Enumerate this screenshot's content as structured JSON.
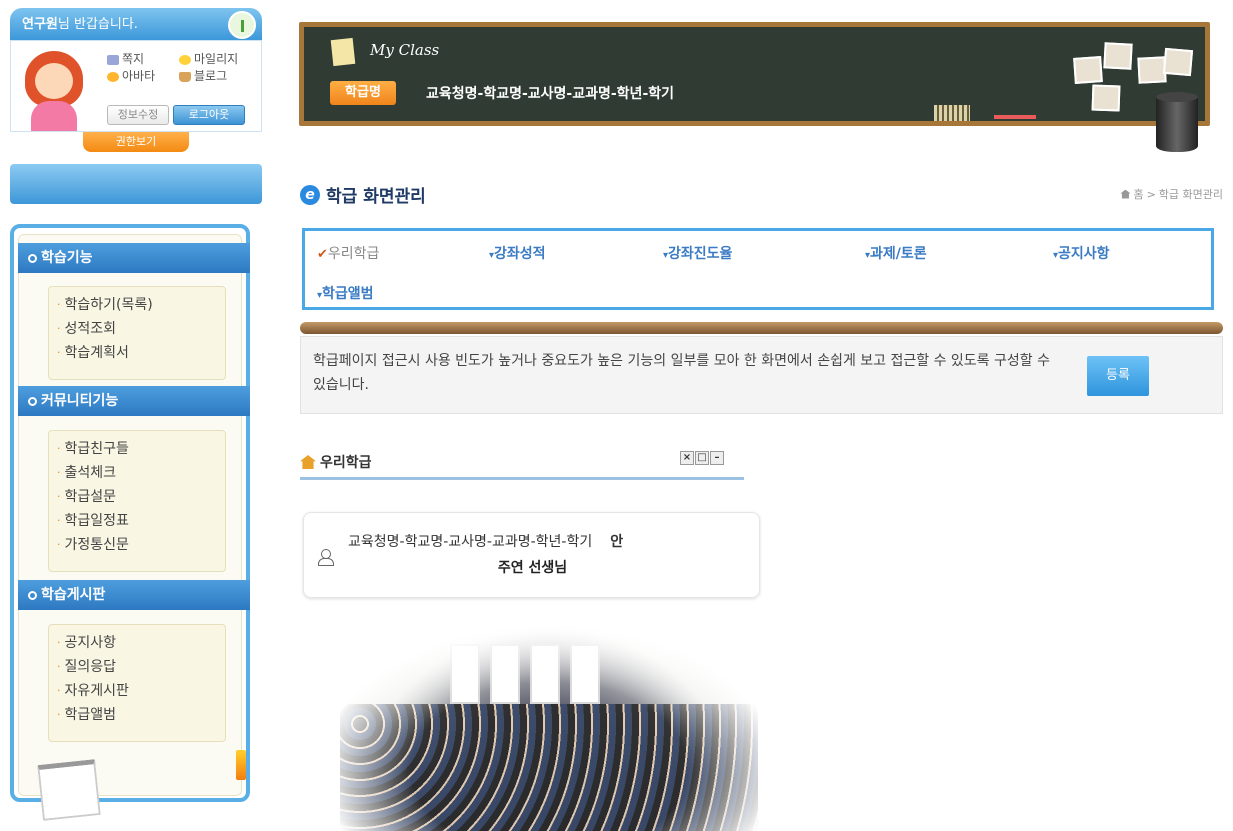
{
  "profile": {
    "user": "연구원",
    "greeting": "님 반갑습니다.",
    "menu": [
      {
        "label": "쪽지",
        "icon": "note-icon"
      },
      {
        "label": "마일리지",
        "icon": "coin-icon"
      },
      {
        "label": "아바타",
        "icon": "smile-icon"
      },
      {
        "label": "블로그",
        "icon": "blog-icon"
      }
    ],
    "edit_label": "정보수정",
    "logout_label": "로그아웃",
    "permission_label": "권한보기"
  },
  "sidebar": {
    "sections": [
      {
        "title": "학습기능",
        "items": [
          "학습하기(목록)",
          "성적조회",
          "학습계획서"
        ]
      },
      {
        "title": "커뮤니티기능",
        "items": [
          "학급친구들",
          "출석체크",
          "학급설문",
          "학급일정표",
          "가정통신문"
        ]
      },
      {
        "title": "학습게시판",
        "items": [
          "공지사항",
          "질의응답",
          "자유게시판",
          "학급앨범"
        ]
      }
    ]
  },
  "banner": {
    "title": "My Class",
    "tab_label": "학급명",
    "class_info": "교육청명-학교명-교사명-교과명-학년-학기"
  },
  "page": {
    "title": "학급 화면관리",
    "breadcrumb": [
      "홈",
      ">",
      "학급 화면관리"
    ]
  },
  "tabs": [
    {
      "label": "우리학급",
      "active": true
    },
    {
      "label": "강좌성적",
      "active": false
    },
    {
      "label": "강좌진도율",
      "active": false
    },
    {
      "label": "과제/토론",
      "active": false
    },
    {
      "label": "공지사항",
      "active": false
    },
    {
      "label": "학급앨범",
      "active": false
    }
  ],
  "description": {
    "text": "학급페이지 접근시 사용 빈도가 높거나 중요도가 높은 기능의 일부를 모아 한 화면에서 손쉽게 보고 접근할 수 있도록 구성할 수 있습니다.",
    "button": "등록"
  },
  "widget": {
    "title": "우리학급",
    "controls": [
      "×",
      "□",
      "–"
    ],
    "class_info": "교육청명-학교명-교사명-교과명-학년-학기",
    "teacher_prefix": "안",
    "teacher_name": "주연 선생님"
  },
  "colors": {
    "accent_blue": "#4aa8e6",
    "accent_orange": "#f0851c",
    "tab_text": "#3a7bc3"
  }
}
